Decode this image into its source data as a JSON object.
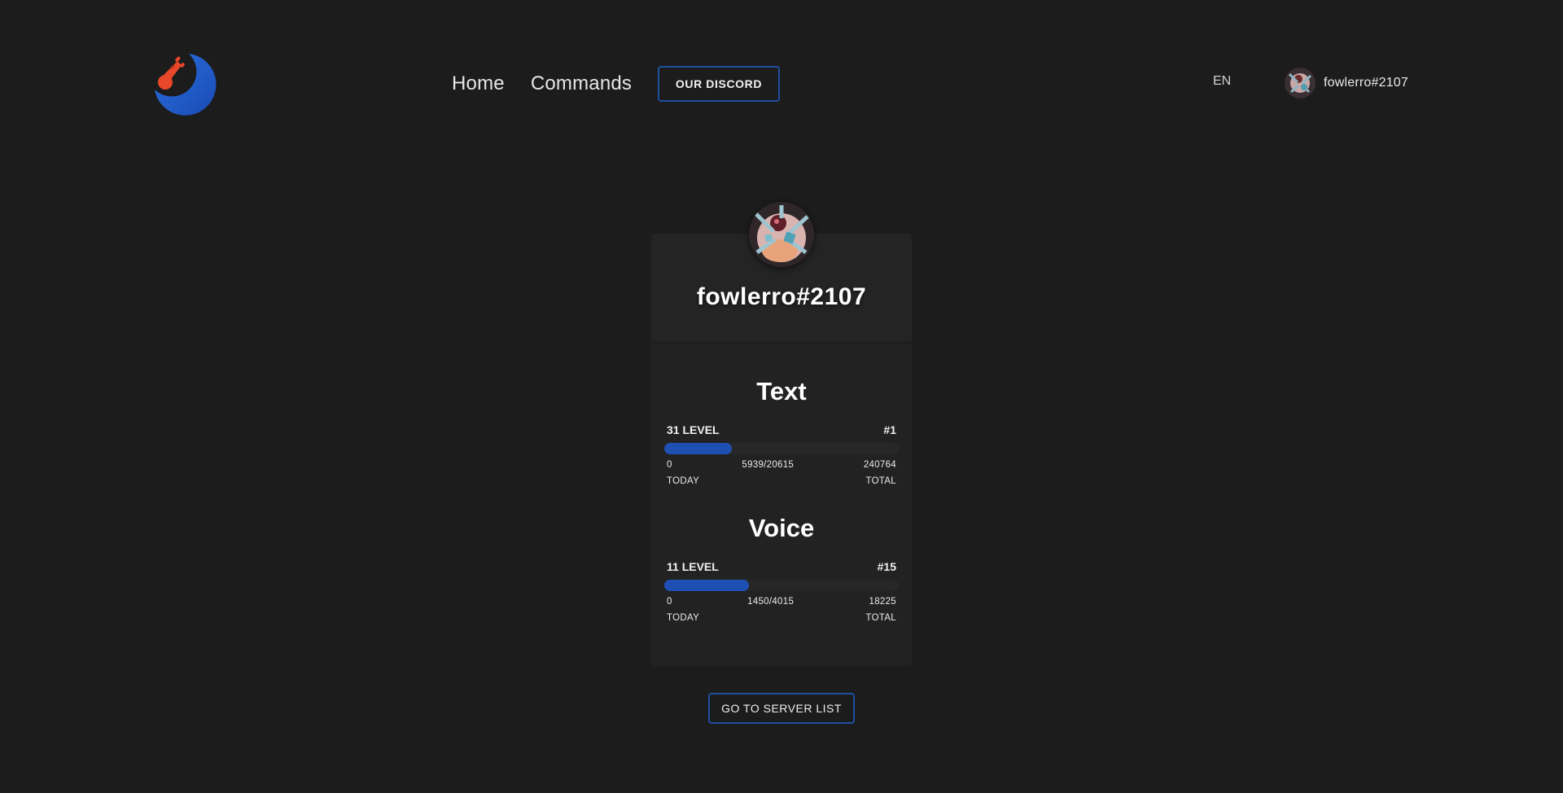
{
  "header": {
    "nav": {
      "home_label": "Home",
      "commands_label": "Commands",
      "discord_label": "OUR DISCORD"
    },
    "language": "EN",
    "user": {
      "name": "fowlerro#2107"
    }
  },
  "profile": {
    "username": "fowlerro#2107",
    "text": {
      "title": "Text",
      "level_label": "31 LEVEL",
      "rank": "#1",
      "progress": 0.288,
      "today_value": "0",
      "xp_progress": "5939/20615",
      "total_value": "240764",
      "today_label": "TODAY",
      "total_label": "TOTAL"
    },
    "voice": {
      "title": "Voice",
      "level_label": "11 LEVEL",
      "rank": "#15",
      "progress": 0.361,
      "today_value": "0",
      "xp_progress": "1450/4015",
      "total_value": "18225",
      "today_label": "TODAY",
      "total_label": "TOTAL"
    }
  },
  "footer": {
    "server_list_label": "GO TO SERVER LIST"
  },
  "colors": {
    "background": "#1c1c1c",
    "card": "#222222",
    "accent": "#1e4fb3",
    "button_border": "#1e4fa0",
    "logo_orange": "#e8472a"
  }
}
